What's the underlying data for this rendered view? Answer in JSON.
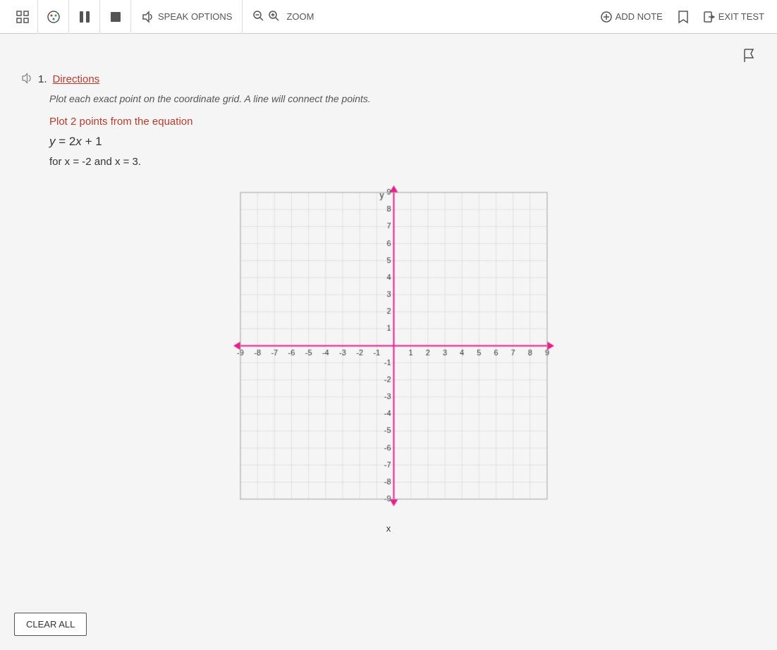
{
  "toolbar": {
    "speak_options_label": "SPEAK OPTIONS",
    "zoom_label": "ZOOM",
    "add_note_label": "ADD NOTE",
    "exit_test_label": "EXIT TEST"
  },
  "question": {
    "number": "1.",
    "directions_label": "Directions",
    "directions_text": "Plot each exact point on the coordinate grid. A line will connect the points.",
    "plot_instruction": "Plot 2 points from the equation",
    "equation": "y = 2x + 1",
    "for_x": "for x = -2 and x = 3."
  },
  "grid": {
    "x_label": "x",
    "y_label": "y",
    "min": -9,
    "max": 9
  },
  "buttons": {
    "clear_all": "CLEAR ALL"
  }
}
